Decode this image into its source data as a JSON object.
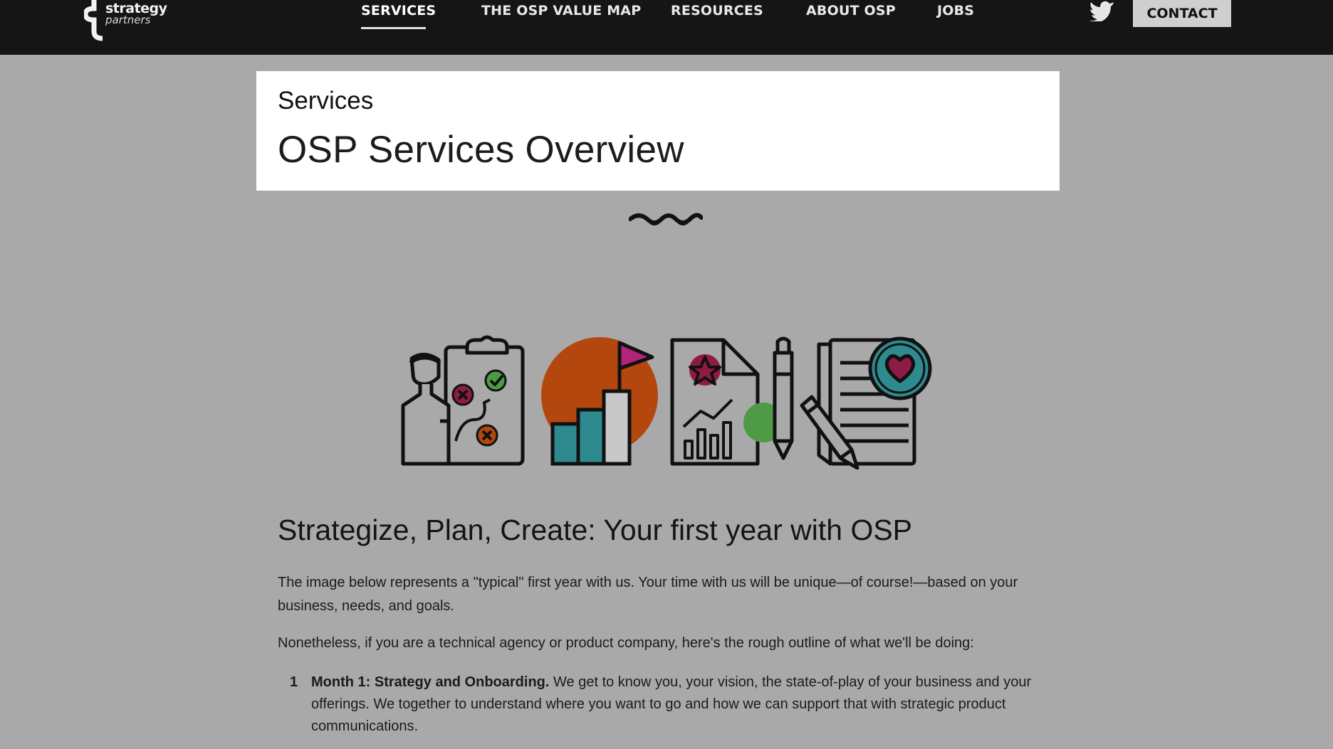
{
  "header": {
    "logo": {
      "wordmark": "strategy",
      "tagline": "partners"
    },
    "nav": [
      {
        "label": "SERVICES",
        "active": true
      },
      {
        "label": "THE OSP VALUE MAP"
      },
      {
        "label": "RESOURCES"
      },
      {
        "label": "ABOUT OSP"
      },
      {
        "label": "JOBS"
      }
    ],
    "social_icon": "twitter-icon",
    "contact_label": "CONTACT"
  },
  "hero": {
    "eyebrow": "Services",
    "title": "OSP Services Overview"
  },
  "illustration": {
    "icons": [
      "strategy-clipboard-icon",
      "growth-flag-chart-icon",
      "report-pen-icon",
      "document-heart-icon"
    ],
    "colors": {
      "maroon": "#8e1b45",
      "orange": "#b3470e",
      "teal": "#2f8a8f",
      "green": "#4e9a47",
      "pink": "#b0247a"
    }
  },
  "content": {
    "heading": "Strategize, Plan, Create: Your first year with OSP",
    "para1": "The image below represents a \"typical\" first year with us. Your time with us will be unique—of course!—based on your business, needs, and goals.",
    "para2": "Nonetheless, if you are a technical agency or product company, here's the rough outline of what we'll be doing:",
    "list": [
      {
        "number": "1",
        "title": "Month 1: Strategy and Onboarding.",
        "text": " We get to know you, your vision, the state-of-play of your business and your offerings. We together to understand where you want to go and how we can support that with strategic product communications."
      }
    ]
  }
}
